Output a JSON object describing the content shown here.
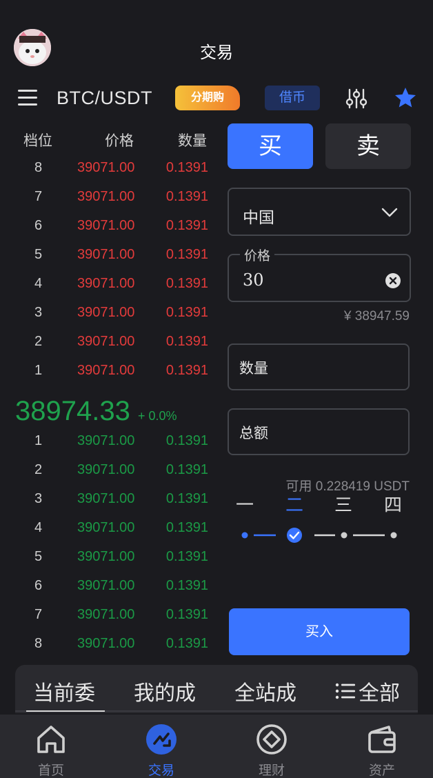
{
  "header": {
    "title": "交易"
  },
  "toolbar": {
    "pair": "BTC/USDT",
    "installment_label": "分期购",
    "borrow_label": "借币"
  },
  "orderbook": {
    "headers": [
      "档位",
      "价格",
      "数量"
    ],
    "asks": [
      {
        "level": "8",
        "price": "39071.00",
        "qty": "0.1391"
      },
      {
        "level": "7",
        "price": "39071.00",
        "qty": "0.1391"
      },
      {
        "level": "6",
        "price": "39071.00",
        "qty": "0.1391"
      },
      {
        "level": "5",
        "price": "39071.00",
        "qty": "0.1391"
      },
      {
        "level": "4",
        "price": "39071.00",
        "qty": "0.1391"
      },
      {
        "level": "3",
        "price": "39071.00",
        "qty": "0.1391"
      },
      {
        "level": "2",
        "price": "39071.00",
        "qty": "0.1391"
      },
      {
        "level": "1",
        "price": "39071.00",
        "qty": "0.1391"
      }
    ],
    "last_price": "38974.33",
    "change": "+ 0.0%",
    "bids": [
      {
        "level": "1",
        "price": "39071.00",
        "qty": "0.1391"
      },
      {
        "level": "2",
        "price": "39071.00",
        "qty": "0.1391"
      },
      {
        "level": "3",
        "price": "39071.00",
        "qty": "0.1391"
      },
      {
        "level": "4",
        "price": "39071.00",
        "qty": "0.1391"
      },
      {
        "level": "5",
        "price": "39071.00",
        "qty": "0.1391"
      },
      {
        "level": "6",
        "price": "39071.00",
        "qty": "0.1391"
      },
      {
        "level": "7",
        "price": "39071.00",
        "qty": "0.1391"
      },
      {
        "level": "8",
        "price": "39071.00",
        "qty": "0.1391"
      }
    ]
  },
  "trade": {
    "buy_tab": "买",
    "sell_tab": "卖",
    "country": "中国",
    "price_label": "价格",
    "price_value": "30",
    "cny_value": "¥ 38947.59",
    "qty_placeholder": "数量",
    "total_placeholder": "总额",
    "available": "可用 0.228419 USDT",
    "percent_options": [
      "一",
      "二",
      "三",
      "四"
    ],
    "selected_percent_index": 1,
    "buy_button": "买入"
  },
  "orders": {
    "tabs": [
      "当前委",
      "我的成",
      "全站成",
      "全部"
    ]
  },
  "nav": {
    "items": [
      {
        "label": "首页",
        "icon": "home-icon"
      },
      {
        "label": "交易",
        "icon": "trade-icon"
      },
      {
        "label": "理财",
        "icon": "finance-icon"
      },
      {
        "label": "资产",
        "icon": "wallet-icon"
      }
    ],
    "active_index": 1
  },
  "colors": {
    "accent": "#3a74ff",
    "ask": "#e33b3b",
    "bid": "#1b9a46"
  }
}
